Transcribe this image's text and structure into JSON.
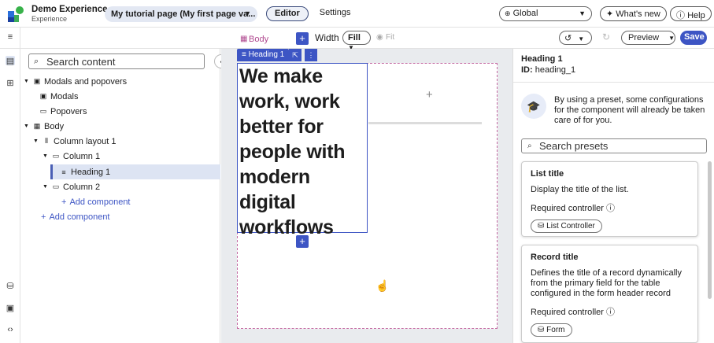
{
  "app": {
    "name": "Demo Experience",
    "subtitle": "Experience"
  },
  "topbar": {
    "page_selector": "My tutorial page (My first page va...",
    "tabs": [
      "Editor",
      "Settings"
    ],
    "scope": "Global",
    "whats_new": "What's new",
    "help": "Help"
  },
  "toolbar": {
    "breadcrumb": "Body",
    "width_label": "Width",
    "width_value": "Fill",
    "fit_label": "Fit",
    "preview": "Preview",
    "save": "Save"
  },
  "tree": {
    "search_placeholder": "Search content",
    "nodes": [
      "Modals and popovers",
      "Modals",
      "Popovers",
      "Body",
      "Column layout 1",
      "Column 1",
      "Heading 1",
      "Column 2",
      "Add component",
      "Add component"
    ]
  },
  "canvas": {
    "tag": "Heading 1",
    "heading_text": "We make work, work better for people with modern digital workflows"
  },
  "panel": {
    "title": "Heading 1",
    "id_label": "ID:",
    "id_value": "heading_1",
    "hint": "By using a preset, some configurations for the component will already be taken care of for you.",
    "search_placeholder": "Search presets",
    "presets": [
      {
        "title": "List title",
        "desc": "Display the title of the list.",
        "req": "Required controller",
        "chip": "List Controller"
      },
      {
        "title": "Record title",
        "desc": "Defines the title of a record dynamically from the primary field for the table configured in the form header record",
        "req": "Required controller",
        "chip": "Form"
      }
    ]
  },
  "colors": {
    "accent": "#3d55c4",
    "canvas_bg": "#e9ebee"
  }
}
